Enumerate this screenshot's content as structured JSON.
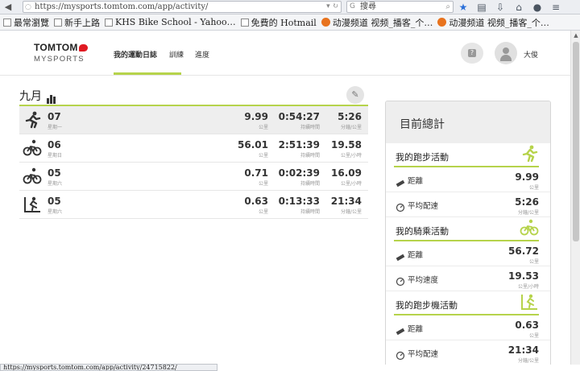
{
  "browser": {
    "url": "https://mysports.tomtom.com/app/activity/",
    "search_engine_icon": "g-icon",
    "search_placeholder": "搜尋",
    "status_url": "https://mysports.tomtom.com/app/activity/24715822/"
  },
  "bookmarks": [
    {
      "label": "最常瀏覽",
      "icon": "folder"
    },
    {
      "label": "新手上路",
      "icon": "page"
    },
    {
      "label": "KHS Bike School - Yahoo…",
      "icon": "page"
    },
    {
      "label": "免費的 Hotmail",
      "icon": "page"
    },
    {
      "label": "动漫频道 视频_播客_个…",
      "icon": "orange"
    },
    {
      "label": "动漫频道 视频_播客_个…",
      "icon": "orange"
    }
  ],
  "nav": {
    "logo_top": "TOMTOM",
    "logo_bottom": "MYSPORTS",
    "tabs": [
      "我的運動日誌",
      "訓練",
      "進度"
    ],
    "user_name": "大俊"
  },
  "log": {
    "month": "九月",
    "activities": [
      {
        "type": "run",
        "day": "07",
        "dow": "星期一",
        "v1": "9.99",
        "u1": "公里",
        "v2": "0:54:27",
        "u2": "持續時間",
        "v3": "5:26",
        "u3": "分鐘/公里"
      },
      {
        "type": "bike",
        "day": "06",
        "dow": "星期日",
        "v1": "56.01",
        "u1": "公里",
        "v2": "2:51:39",
        "u2": "持續時間",
        "v3": "19.58",
        "u3": "公里/小時"
      },
      {
        "type": "bike",
        "day": "05",
        "dow": "星期六",
        "v1": "0.71",
        "u1": "公里",
        "v2": "0:02:39",
        "u2": "持續時間",
        "v3": "16.09",
        "u3": "公里/小時"
      },
      {
        "type": "treadmill",
        "day": "05",
        "dow": "星期六",
        "v1": "0.63",
        "u1": "公里",
        "v2": "0:13:33",
        "u2": "持續時間",
        "v3": "21:34",
        "u3": "分鐘/公里"
      }
    ]
  },
  "summary": {
    "title": "目前總計",
    "sections": [
      {
        "title": "我的跑步活動",
        "icon": "run",
        "stats": [
          {
            "icon": "ruler",
            "label": "距離",
            "value": "9.99",
            "unit": "公里"
          },
          {
            "icon": "gauge",
            "label": "平均配速",
            "value": "5:26",
            "unit": "分鐘/公里"
          }
        ]
      },
      {
        "title": "我的騎乘活動",
        "icon": "bike",
        "stats": [
          {
            "icon": "ruler",
            "label": "距離",
            "value": "56.72",
            "unit": "公里"
          },
          {
            "icon": "gauge",
            "label": "平均速度",
            "value": "19.53",
            "unit": "公里/小時"
          }
        ]
      },
      {
        "title": "我的跑步機活動",
        "icon": "treadmill",
        "stats": [
          {
            "icon": "ruler",
            "label": "距離",
            "value": "0.63",
            "unit": "公里"
          },
          {
            "icon": "gauge",
            "label": "平均配速",
            "value": "21:34",
            "unit": "分鐘/公里"
          }
        ]
      }
    ]
  },
  "colors": {
    "accent": "#b6d34b",
    "text": "#333333",
    "muted": "#999999"
  }
}
